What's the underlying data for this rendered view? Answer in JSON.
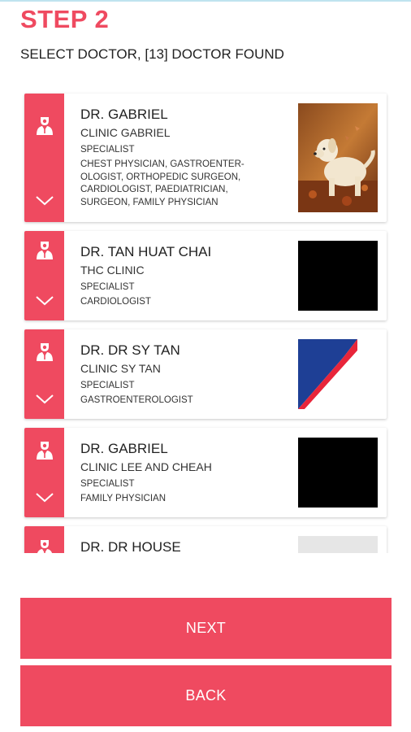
{
  "header": {
    "step_title": "STEP 2",
    "subtitle": "SELECT DOCTOR, [13] DOCTOR FOUND"
  },
  "colors": {
    "accent": "#ef4a60",
    "flag_blue": "#1e3f95",
    "flag_red": "#e8253a"
  },
  "doctors": [
    {
      "name": "DR. GABRIEL",
      "clinic": "CLINIC GABRIEL",
      "role": "SPECIALIST",
      "specialties": "CHEST PHYSICIAN, GASTROENTER-OLOGIST, ORTHOPEDIC SURGEON, CARDIOLOGIST, PAEDIATRICIAN, SURGEON, FAMILY PHYSICIAN",
      "specialty_lines": [
        "CHEST PHYSICIAN, GASTROENTER-",
        "OLOGIST, ORTHOPEDIC SURGEON,",
        "CARDIOLOGIST, PAEDIATRICIAN,",
        "SURGEON, FAMILY PHYSICIAN"
      ],
      "thumbnail": "puppy-photo"
    },
    {
      "name": "DR. TAN HUAT CHAI",
      "clinic": "THC CLINIC",
      "role": "SPECIALIST",
      "specialty_lines": [
        "CARDIOLOGIST"
      ],
      "thumbnail": "black"
    },
    {
      "name": "DR. DR SY TAN",
      "clinic": "CLINIC SY TAN",
      "role": "SPECIALIST",
      "specialty_lines": [
        "GASTROENTEROLOGIST"
      ],
      "thumbnail": "blue-red-logo"
    },
    {
      "name": "DR. GABRIEL",
      "clinic": "CLINIC LEE AND CHEAH",
      "role": "SPECIALIST",
      "specialty_lines": [
        "FAMILY PHYSICIAN"
      ],
      "thumbnail": "black"
    },
    {
      "name": "DR. DR HOUSE",
      "thumbnail": "light-gray"
    }
  ],
  "icons": {
    "doctor": "doctor-icon",
    "expand": "chevron-down-icon"
  },
  "buttons": {
    "next": "NEXT",
    "back": "BACK"
  }
}
